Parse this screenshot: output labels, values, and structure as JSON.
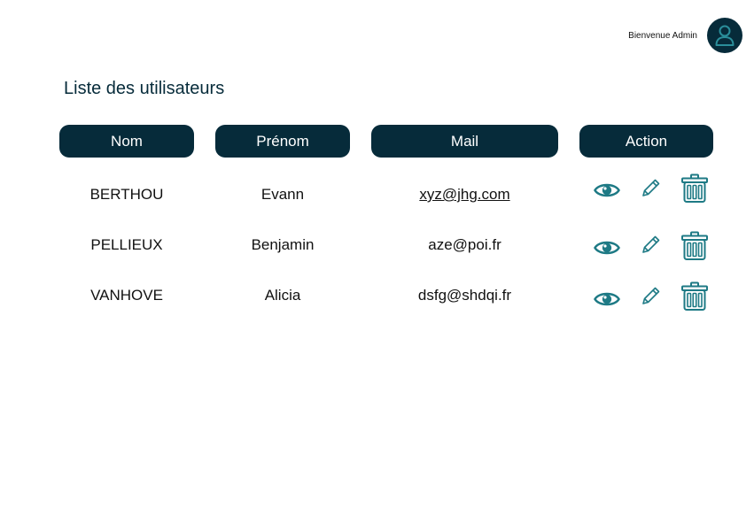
{
  "header": {
    "welcome_text": "Bienvenue Admin",
    "avatar_icon": "user-icon"
  },
  "page": {
    "title": "Liste des utilisateurs"
  },
  "table": {
    "columns": [
      "Nom",
      "Prénom",
      "Mail",
      "Action"
    ],
    "rows": [
      {
        "nom": "BERTHOU",
        "prenom": "Evann",
        "mail": "xyz@jhg.com",
        "mail_linked": true
      },
      {
        "nom": "PELLIEUX",
        "prenom": "Benjamin",
        "mail": "aze@poi.fr",
        "mail_linked": false
      },
      {
        "nom": "VANHOVE",
        "prenom": "Alicia",
        "mail": "dsfg@shdqi.fr",
        "mail_linked": false
      }
    ],
    "actions": [
      "eye-icon",
      "pencil-icon",
      "trash-icon"
    ]
  },
  "colors": {
    "primary_dark": "#062b3a",
    "icon_teal": "#1e7a85",
    "header_text": "#ffffff",
    "background": "#ffffff"
  }
}
